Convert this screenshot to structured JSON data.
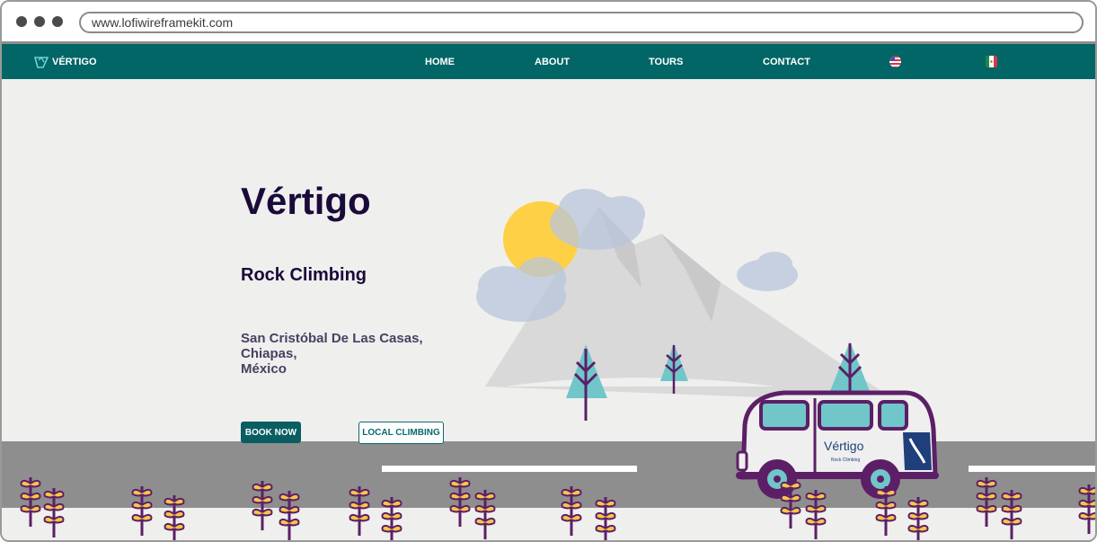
{
  "browser": {
    "url": "www.lofiwireframekit.com"
  },
  "nav": {
    "brand": "VÉRTIGO",
    "links": [
      "HOME",
      "ABOUT",
      "TOURS",
      "CONTACT"
    ],
    "language_flags": [
      "us-flag-icon",
      "mexico-flag-icon"
    ]
  },
  "hero": {
    "title": "Vértigo",
    "subtitle": "Rock Climbing",
    "location_line1": "San Cristóbal De Las Casas,",
    "location_line2": "Chiapas,",
    "location_line3": "México",
    "primary_button": "BOOK NOW",
    "secondary_button": "LOCAL CLIMBING"
  },
  "van": {
    "logo_text": "Vértigo",
    "tagline": "Rock Climbing"
  },
  "colors": {
    "nav_bg": "#026666",
    "title": "#1a0a3a",
    "button_bg": "#0a5e62",
    "sun": "#fdd046",
    "mountain": "#d9d9d9",
    "tree": "#70c6c9",
    "plant_stem": "#5c1f66",
    "plant_leaf": "#f7c548",
    "road": "#8e8e8e"
  }
}
